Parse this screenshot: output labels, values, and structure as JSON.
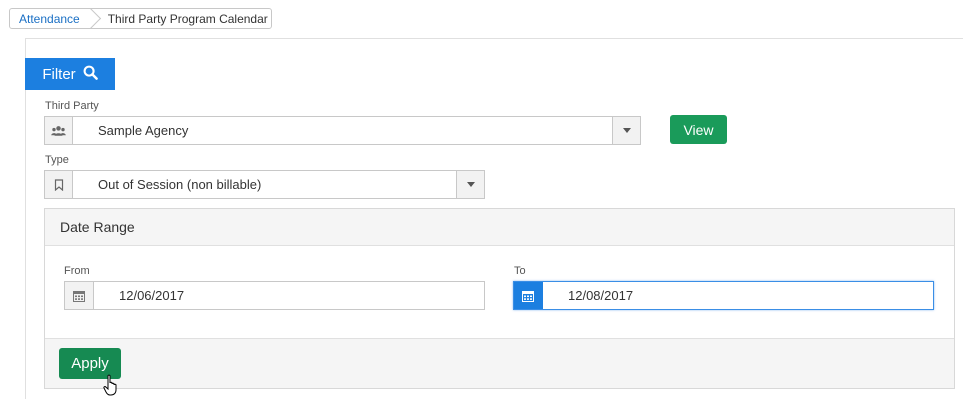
{
  "breadcrumb": {
    "items": [
      {
        "label": "Attendance"
      },
      {
        "label": "Third Party Program Calendar"
      }
    ]
  },
  "filter": {
    "label": "Filter",
    "icon": "search-icon"
  },
  "third_party": {
    "label": "Third Party",
    "value": "Sample Agency",
    "icon": "group-icon"
  },
  "view_button": {
    "label": "View"
  },
  "type": {
    "label": "Type",
    "value": "Out of Session (non billable)",
    "icon": "bookmark-icon"
  },
  "date_range": {
    "title": "Date Range",
    "from": {
      "label": "From",
      "value": "12/06/2017",
      "icon": "calendar-icon"
    },
    "to": {
      "label": "To",
      "value": "12/08/2017",
      "icon": "calendar-icon"
    }
  },
  "apply_button": {
    "label": "Apply"
  },
  "colors": {
    "accent": "#1c7fe0",
    "success": "#1a9b5a",
    "link": "#1a6fc4"
  }
}
